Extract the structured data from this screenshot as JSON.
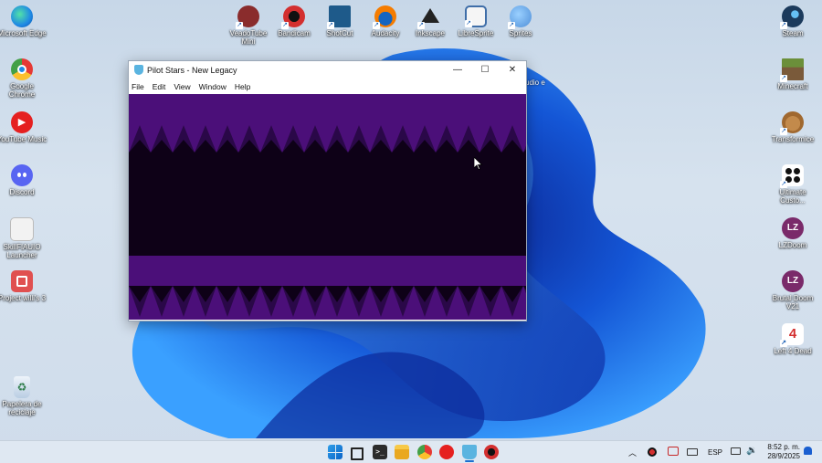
{
  "desktop": {
    "left_icons": [
      {
        "label": "Microsoft Edge",
        "icon": "edge-icon",
        "color": "#1e88e5"
      },
      {
        "label": "Google Chrome",
        "icon": "chrome-icon",
        "color": "#e53935"
      },
      {
        "label": "YouTube Music",
        "icon": "youtube-music-icon",
        "color": "#e52020"
      },
      {
        "label": "Discord",
        "icon": "discord-icon",
        "color": "#5865f2"
      },
      {
        "label": "SkillFlAUIO Launcher",
        "icon": "launcher-icon",
        "color": "#f2f2f2"
      },
      {
        "label": "Project willi's 3",
        "icon": "project-icon",
        "color": "#e05050"
      },
      {
        "label": "Papelera de reciclaje",
        "icon": "recycle-bin-icon",
        "color": "#dfe9f5"
      }
    ],
    "top_icons": [
      {
        "label": "VeadoTube Mini",
        "icon": "veadotube-icon",
        "color": "#8a2c2c"
      },
      {
        "label": "Bandicam",
        "icon": "bandicam-icon",
        "color": "#d32f2f"
      },
      {
        "label": "ShotCut",
        "icon": "shotcut-icon",
        "color": "#1e5a8a"
      },
      {
        "label": "Audacity",
        "icon": "audacity-icon",
        "color": "#f57c00"
      },
      {
        "label": "Inkscape",
        "icon": "inkscape-icon",
        "color": "#222222"
      },
      {
        "label": "LibreSprite",
        "icon": "libresprite-icon",
        "color": "#3f6ea8"
      },
      {
        "label": "Sprites",
        "icon": "sprites-icon",
        "color": "#4f8fd8"
      }
    ],
    "right_icons": [
      {
        "label": "Steam",
        "icon": "steam-icon",
        "color": "#1b3a5c"
      },
      {
        "label": "Minecraft",
        "icon": "minecraft-icon",
        "color": "#6b8f3a"
      },
      {
        "label": "Transformice",
        "icon": "transformice-icon",
        "color": "#a0682f"
      },
      {
        "label": "Ultimate Custo...",
        "icon": "ultimate-custom-icon",
        "color": "#ffffff"
      },
      {
        "label": "LZDoom",
        "icon": "lzdoom-icon",
        "color": "#7a2a6a"
      },
      {
        "label": "Brutal Doom V21",
        "icon": "brutal-doom-icon",
        "color": "#7a2a6a"
      },
      {
        "label": "Left 4 Dead",
        "icon": "left4dead-icon",
        "color": "#d32f2f"
      }
    ],
    "partial_label": "udio e"
  },
  "window": {
    "title": "Pilot Stars - New Legacy",
    "menu": [
      "File",
      "Edit",
      "View",
      "Window",
      "Help"
    ],
    "minimize": "—",
    "maximize": "☐",
    "close": "✕",
    "canvas_color": "#0e0117",
    "zigzag_color": "#4b0f79"
  },
  "taskbar": {
    "language": "ESP",
    "time": "8:52 p. m.",
    "date": "28/9/2025",
    "apps": [
      "windows-start-icon",
      "task-view-icon",
      "terminal-icon",
      "file-explorer-icon",
      "chrome-icon",
      "youtube-music-icon",
      "pilot-stars-icon",
      "bandicam-icon"
    ]
  }
}
